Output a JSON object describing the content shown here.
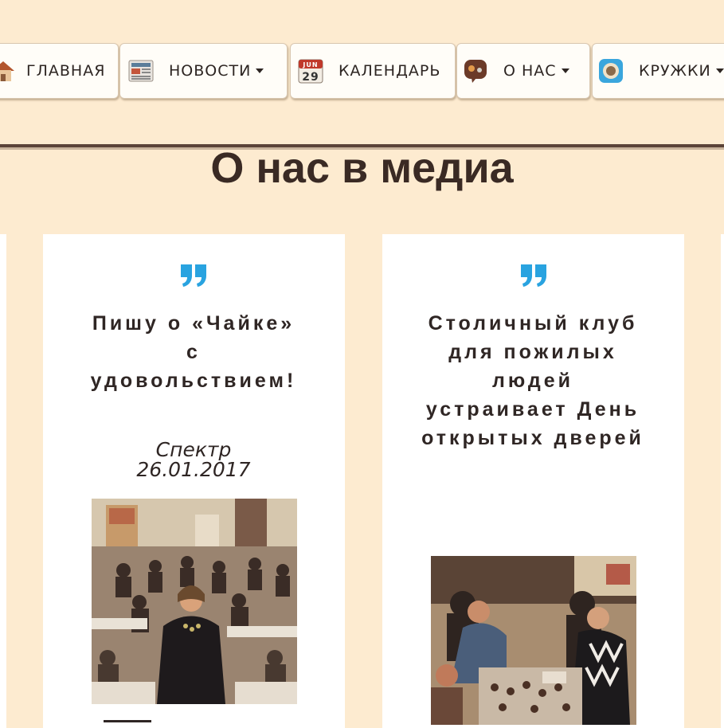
{
  "nav": {
    "items": [
      {
        "label": "ГЛАВНАЯ",
        "icon": "home-icon",
        "dropdown": false
      },
      {
        "label": "НОВОСТИ",
        "icon": "newspaper-icon",
        "dropdown": true
      },
      {
        "label": "КАЛЕНДАРЬ",
        "icon": "calendar-icon",
        "dropdown": false,
        "icon_text_month": "JUN",
        "icon_text_day": "29"
      },
      {
        "label": "О НАС",
        "icon": "chat-icon",
        "dropdown": true
      },
      {
        "label": "КРУЖКИ",
        "icon": "camera-icon",
        "dropdown": true
      }
    ]
  },
  "page": {
    "title": "О нас в медиа"
  },
  "cards": [
    {
      "title": "Пишу о «Чайке» с удовольствием!",
      "source": "Спектр",
      "date": "26.01.2017",
      "photo": "group-meeting-photo"
    },
    {
      "title": "Столичный клуб для пожилых людей устраивает День открытых дверей",
      "photo": "crafts-workshop-photo"
    }
  ],
  "colors": {
    "background": "#fdebd0",
    "accent_quote": "#29a3e0",
    "divider": "#5b4338",
    "text": "#2f2624"
  }
}
